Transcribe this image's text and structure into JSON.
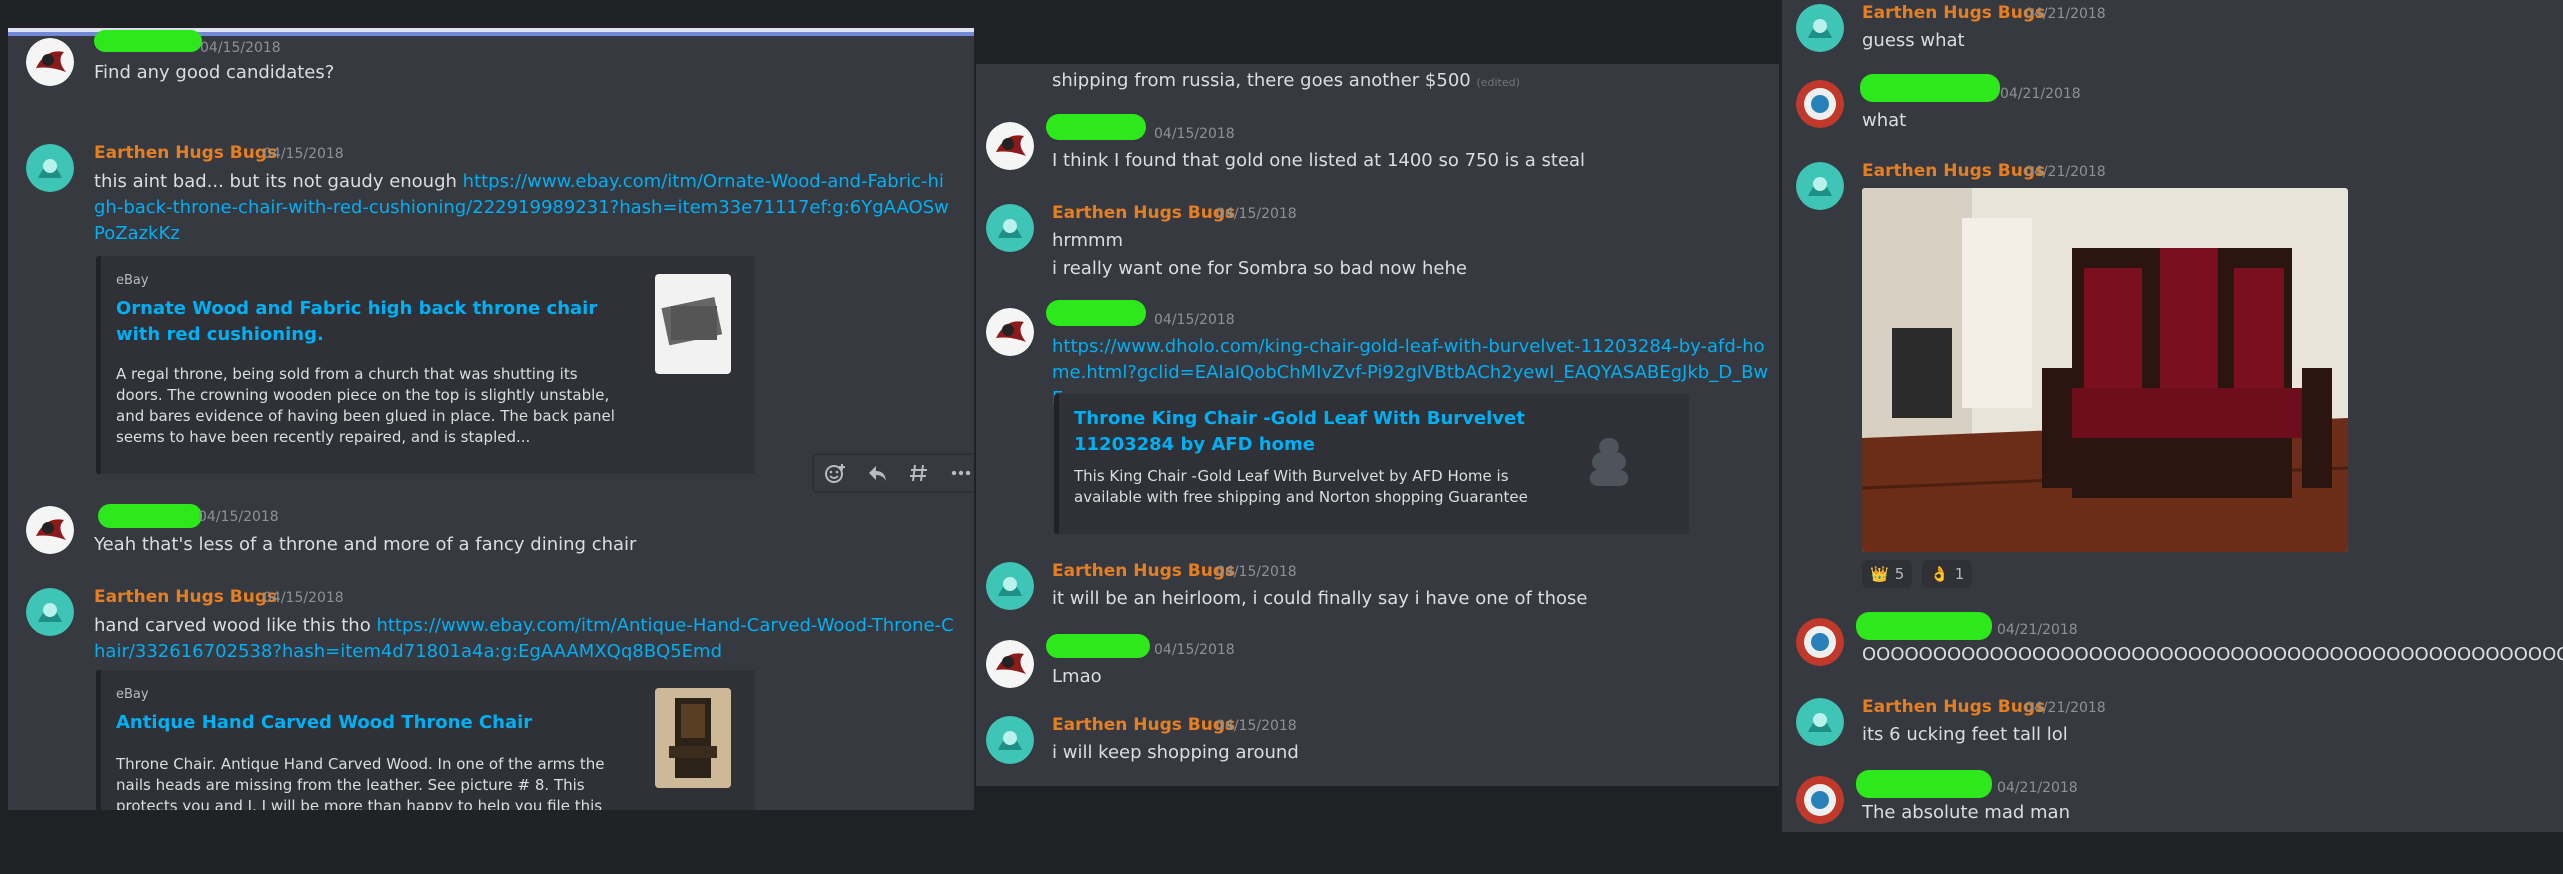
{
  "panel1": {
    "m1": {
      "time": "04/15/2018",
      "text": "Find any good candidates?"
    },
    "m2": {
      "author": "Earthen Hugs Bugs",
      "time": "04/15/2018",
      "text": "this aint bad... but its not gaudy enough ",
      "link": "https://www.ebay.com/itm/Ornate-Wood-and-Fabric-high-back-throne-chair-with-red-cushioning/222919989231?hash=item33e71117ef:g:6YgAAOSwPoZazkKz",
      "embed": {
        "provider": "eBay",
        "title": "Ornate Wood and Fabric high back throne chair with red cushioning.",
        "desc": "A regal throne, being sold from a church that was shutting its doors. The crowning wooden piece on the top is slightly unstable, and bares evidence of having been glued in place. The back panel seems to have been recently repaired, and is stapled..."
      }
    },
    "m3": {
      "time": "04/15/2018",
      "text": "Yeah that's less of a throne and more of a fancy dining chair"
    },
    "m4": {
      "author": "Earthen Hugs Bugs",
      "time": "04/15/2018",
      "text": "hand carved wood like this tho ",
      "link": "https://www.ebay.com/itm/Antique-Hand-Carved-Wood-Throne-Chair/332616702538?hash=item4d71801a4a:g:EgAAAMXQq8BQ5Emd",
      "embed": {
        "provider": "eBay",
        "title": "Antique Hand Carved Wood Throne Chair",
        "desc": "Throne Chair. Antique Hand Carved Wood. In one of the arms the nails heads are missing from the leather. See picture # 8. This protects you and I. I will be more than happy to help you file this claim. | eBay!"
      }
    }
  },
  "panel2": {
    "m1": {
      "text": "shipping from russia, there goes another $500 ",
      "edited": "(edited)"
    },
    "m2": {
      "time": "04/15/2018",
      "text": "I think I found that gold one listed at 1400 so 750 is a steal"
    },
    "m3": {
      "author": "Earthen Hugs Bugs",
      "time": "04/15/2018",
      "text1": "hrmmm",
      "text2": "i really want one for Sombra so bad now hehe"
    },
    "m4": {
      "time": "04/15/2018",
      "link": "https://www.dholo.com/king-chair-gold-leaf-with-burvelvet-11203284-by-afd-home.html?gclid=EAIaIQobChMIvZvf-Pi92gIVBtbACh2yewI_EAQYASABEgJkb_D_BwE",
      "embed": {
        "title": "Throne King Chair -Gold Leaf With Burvelvet 11203284 by AFD home",
        "desc": "This King Chair -Gold Leaf With Burvelvet by AFD Home is available with free shipping and Norton shopping Guarantee"
      }
    },
    "m5": {
      "author": "Earthen Hugs Bugs",
      "time": "04/15/2018",
      "text": "it will be an heirloom, i could finally say i have one of those"
    },
    "m6": {
      "time": "04/15/2018",
      "text": "Lmao"
    },
    "m7": {
      "author": "Earthen Hugs Bugs",
      "time": "04/15/2018",
      "text": "i will keep shopping around"
    }
  },
  "panel3": {
    "m1": {
      "author": "Earthen Hugs Bugs",
      "time": "04/21/2018",
      "text": "guess what"
    },
    "m2": {
      "time": "04/21/2018",
      "text": "what"
    },
    "m3": {
      "author": "Earthen Hugs Bugs",
      "time": "04/21/2018",
      "reactions": [
        {
          "emoji": "👑",
          "count": "5",
          "emoji_name": "crown"
        },
        {
          "emoji": "👌",
          "count": "1",
          "emoji_name": "ok-hand"
        }
      ]
    },
    "m4": {
      "time": "04/21/2018",
      "text": "OOOOOOOOOOOOOOOOOOOOOOOOOOOOOOOOOOOOOOOOOOOOOOOOOOOOOOO"
    },
    "m5": {
      "author": "Earthen Hugs Bugs",
      "time": "04/21/2018",
      "text": "its 6 ucking feet tall lol"
    },
    "m6": {
      "time": "04/21/2018",
      "text": "The absolute mad man"
    }
  },
  "icons": {
    "toolbar": [
      "add-reaction-icon",
      "reply-icon",
      "create-thread-icon",
      "more-icon"
    ]
  },
  "colors": {
    "background": "#36393f",
    "embed": "#2f3136",
    "link": "#00aff4",
    "author_orange": "#e67e22",
    "scribble": "#2de81a"
  }
}
